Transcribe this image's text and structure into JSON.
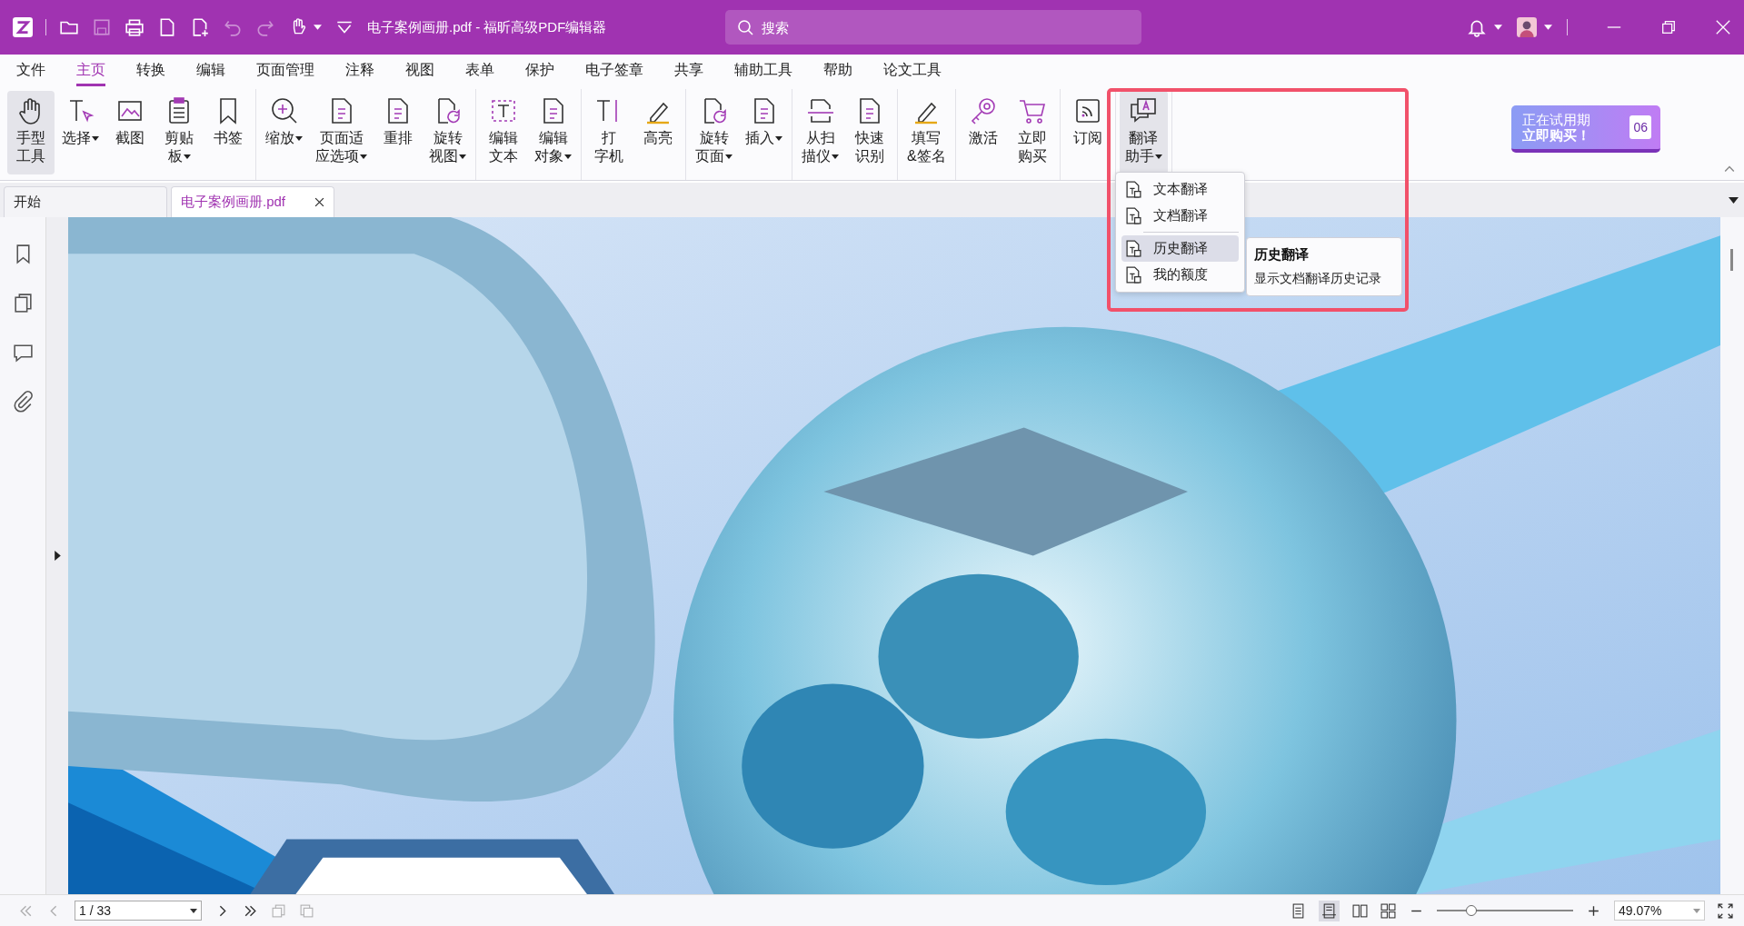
{
  "window": {
    "title": "电子案例画册.pdf - 福昕高级PDF编辑器"
  },
  "search": {
    "placeholder": "搜索"
  },
  "menu_tabs": [
    {
      "label": "文件",
      "selected": false
    },
    {
      "label": "主页",
      "selected": true
    },
    {
      "label": "转换",
      "selected": false
    },
    {
      "label": "编辑",
      "selected": false
    },
    {
      "label": "页面管理",
      "selected": false
    },
    {
      "label": "注释",
      "selected": false
    },
    {
      "label": "视图",
      "selected": false
    },
    {
      "label": "表单",
      "selected": false
    },
    {
      "label": "保护",
      "selected": false
    },
    {
      "label": "电子签章",
      "selected": false
    },
    {
      "label": "共享",
      "selected": false
    },
    {
      "label": "辅助工具",
      "selected": false
    },
    {
      "label": "帮助",
      "selected": false
    },
    {
      "label": "论文工具",
      "selected": false
    }
  ],
  "ribbon_groups": [
    {
      "items": [
        {
          "lines": [
            "手型",
            "工具"
          ],
          "dropdown": false,
          "selected": true
        },
        {
          "lines": [
            "选择"
          ],
          "dropdown": true,
          "selected": false
        },
        {
          "lines": [
            "截图"
          ],
          "dropdown": false,
          "selected": false
        },
        {
          "lines": [
            "剪贴",
            "板"
          ],
          "dropdown": true,
          "selected": false
        },
        {
          "lines": [
            "书签"
          ],
          "dropdown": false,
          "selected": false
        }
      ]
    },
    {
      "items": [
        {
          "lines": [
            "缩放"
          ],
          "dropdown": true,
          "selected": false
        },
        {
          "lines": [
            "页面适",
            "应选项"
          ],
          "dropdown": true,
          "selected": false
        },
        {
          "lines": [
            "重排"
          ],
          "dropdown": false,
          "selected": false
        },
        {
          "lines": [
            "旋转",
            "视图"
          ],
          "dropdown": true,
          "selected": false
        }
      ]
    },
    {
      "items": [
        {
          "lines": [
            "编辑",
            "文本"
          ],
          "dropdown": false,
          "selected": false
        },
        {
          "lines": [
            "编辑",
            "对象"
          ],
          "dropdown": true,
          "selected": false
        }
      ]
    },
    {
      "items": [
        {
          "lines": [
            "打",
            "字机"
          ],
          "dropdown": false,
          "selected": false
        },
        {
          "lines": [
            "高亮"
          ],
          "dropdown": false,
          "selected": false
        }
      ]
    },
    {
      "items": [
        {
          "lines": [
            "旋转",
            "页面"
          ],
          "dropdown": true,
          "selected": false
        },
        {
          "lines": [
            "插入"
          ],
          "dropdown": true,
          "selected": false
        }
      ]
    },
    {
      "items": [
        {
          "lines": [
            "从扫",
            "描仪"
          ],
          "dropdown": true,
          "selected": false
        },
        {
          "lines": [
            "快速",
            "识别"
          ],
          "dropdown": false,
          "selected": false
        }
      ]
    },
    {
      "items": [
        {
          "lines": [
            "填写",
            "&签名"
          ],
          "dropdown": false,
          "selected": false
        }
      ]
    },
    {
      "items": [
        {
          "lines": [
            "激活"
          ],
          "dropdown": false,
          "selected": false
        },
        {
          "lines": [
            "立即",
            "购买"
          ],
          "dropdown": false,
          "selected": false
        }
      ]
    },
    {
      "items": [
        {
          "lines": [
            "订阅"
          ],
          "dropdown": false,
          "selected": false
        }
      ]
    },
    {
      "items": [
        {
          "lines": [
            "翻译",
            "助手"
          ],
          "dropdown": true,
          "selected": true
        }
      ]
    }
  ],
  "trial_badge": {
    "status": "正在试用期",
    "action": "立即购买！",
    "days": "06"
  },
  "doc_tabs": [
    {
      "label": "开始",
      "selected": false,
      "closable": false
    },
    {
      "label": "电子案例画册.pdf",
      "selected": true,
      "closable": true
    }
  ],
  "translate_menu": {
    "items": [
      {
        "label": "文本翻译",
        "selected": false
      },
      {
        "label": "文档翻译",
        "selected": false
      },
      {
        "label": "历史翻译",
        "selected": true
      },
      {
        "label": "我的额度",
        "selected": false
      }
    ],
    "tooltip": {
      "title": "历史翻译",
      "text": "显示文档翻译历史记录"
    }
  },
  "status_bar": {
    "page": "1 / 33",
    "zoom": {
      "level": 0.25,
      "value": "49.07%"
    }
  }
}
